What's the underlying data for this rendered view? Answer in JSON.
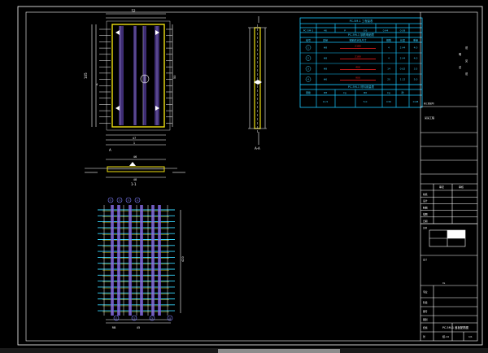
{
  "top_view": {
    "dims": [
      "52",
      "105",
      "47",
      "1",
      "4",
      "50"
    ],
    "section_mark": "A"
  },
  "side_view": {
    "label": "A-A"
  },
  "section": {
    "label": "1-1",
    "dims": [
      "46",
      "48"
    ]
  },
  "rebar": {
    "dims": [
      "420",
      "45",
      "RB"
    ],
    "bar_marks": [
      "①",
      "②",
      "③",
      "④"
    ]
  },
  "table1": {
    "header": "PC-5M-1 工程量表",
    "cols": [
      "PC-5M-1",
      "46",
      "P",
      "0.6",
      "0.44",
      "0.08"
    ]
  },
  "table2": {
    "header": "PC-5M-1 钢筋明细表",
    "cols": [
      "编号",
      "直径",
      "钢筋形状及尺寸",
      "根数",
      "长度",
      "重量"
    ],
    "rows": [
      {
        "mark": "1",
        "dia": "Φ8",
        "shape": "2180",
        "n": "4",
        "len": "2.44",
        "wt": "4.0"
      },
      {
        "mark": "2",
        "dia": "Φ8",
        "shape": "2180",
        "n": "4",
        "len": "2.44",
        "wt": "4.0"
      },
      {
        "mark": "3",
        "dia": "Φ8",
        "shape": "400",
        "n": "14",
        "len": "0.62",
        "wt": "3.5"
      },
      {
        "mark": "4",
        "dia": "Φ6",
        "shape": "900",
        "n": "20",
        "len": "1.12",
        "wt": "5.0"
      }
    ]
  },
  "table3": {
    "header": "PC-5M-1 材料用量表",
    "cols": [
      "钢筋",
      "Φ8",
      "kg",
      "Φ6",
      "kg",
      "砼"
    ],
    "vals": [
      "11.5",
      "5.0",
      "C30",
      "0.08"
    ]
  },
  "notes": {
    "lines": [
      "说",
      "明",
      "见",
      "总",
      "说"
    ],
    "bottom": "施工图说明"
  },
  "title_block": {
    "approve": "审定",
    "review": "审核",
    "items": [
      "校核",
      "设计",
      "制图",
      "描图",
      "日期"
    ],
    "scale_label": "比例",
    "project": "某某工程",
    "tag": "设计",
    "tag2": "专业",
    "tag3": "阶段",
    "tag4": "图号",
    "drawing_name": "PC-5M-1 盖板配筋图",
    "drawing_no": "结-14",
    "sheet": "张",
    "sheet_no": "1/1",
    "drawing_code": "图别",
    "drawing_code_val": "结施",
    "code": "XL"
  }
}
